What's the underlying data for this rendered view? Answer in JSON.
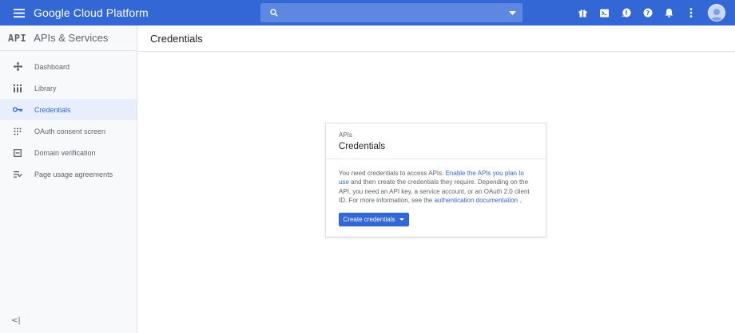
{
  "topbar": {
    "brand": "Google Cloud Platform",
    "search_placeholder": "",
    "icons": [
      "gift-icon",
      "cloud-shell-icon",
      "notifications-alert-icon",
      "help-icon",
      "bell-icon",
      "more-vert-icon",
      "avatar"
    ]
  },
  "sidebar": {
    "logo": "API",
    "title": "APIs & Services",
    "items": [
      {
        "label": "Dashboard",
        "icon": "dashboard-icon"
      },
      {
        "label": "Library",
        "icon": "library-icon"
      },
      {
        "label": "Credentials",
        "icon": "key-icon",
        "active": true
      },
      {
        "label": "OAuth consent screen",
        "icon": "oauth-icon"
      },
      {
        "label": "Domain verification",
        "icon": "domain-icon"
      },
      {
        "label": "Page usage agreements",
        "icon": "agreements-icon"
      }
    ],
    "collapse": "<|"
  },
  "main": {
    "page_title": "Credentials"
  },
  "card": {
    "eyebrow": "APIs",
    "title": "Credentials",
    "body_1": "You need credentials to access APIs. ",
    "link_1": "Enable the APIs you plan to use",
    "body_2": " and then create the credentials they require. Depending on the API, you need an API key, a service account, or an OAuth 2.0 client ID. For more information, see the ",
    "link_2": "authentication documentation",
    "body_3": " .",
    "button": "Create credentials"
  },
  "colors": {
    "brand_blue": "#3367d6",
    "search_bg": "#5e87e1",
    "sidebar_bg": "#f8f9fa",
    "active_bg": "#e8eefc"
  }
}
